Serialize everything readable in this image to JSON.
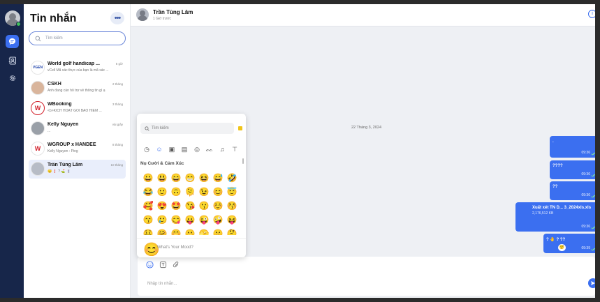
{
  "sidebar": {
    "title": "Tin nhắn",
    "search_placeholder": "Tìm kiếm",
    "conversations": [
      {
        "name": "World golf handicap ...",
        "time": "6 giờ",
        "preview": "vCell Mã xác thực của bạn là mã xác ...",
        "avatar": "VGEN"
      },
      {
        "name": "CSKH",
        "time": "2 tháng",
        "preview": "Anh đang cần hỗ trợ về thông tin gì ạ",
        "avatar": ""
      },
      {
        "name": "WBooking",
        "time": "3 tháng",
        "preview": "<b>KÍCH HOẠT GÓI BẢO HIỂM ...",
        "avatar": "W"
      },
      {
        "name": "Kelly Nguyen",
        "time": "vài giây",
        "preview": "...",
        "avatar": ""
      },
      {
        "name": "WGROUP x HANDEE",
        "time": "8 tháng",
        "preview": "Kelly Nguyen : Ping",
        "avatar": "W"
      },
      {
        "name": "Trần Tùng Lâm",
        "time": "10 tháng",
        "preview": "😴 ❗ ? ⛳ 💈",
        "avatar": ""
      }
    ]
  },
  "header": {
    "name": "Trần Tùng Lâm",
    "status": "1 Giờ trước"
  },
  "chat": {
    "date": "22 Tháng 3, 2024",
    "messages": [
      {
        "text": ".",
        "sub": "",
        "time": "09:36"
      },
      {
        "text": "????",
        "sub": "",
        "time": "09:36"
      },
      {
        "text": "??",
        "sub": "",
        "time": "09:36"
      },
      {
        "text": "Xuất xét TN D... 3_2024xls.xls",
        "sub": "2,176,512 KB",
        "time": "09:36"
      },
      {
        "text": "? 🤚 ? ??",
        "sub": "",
        "time": "09:39",
        "reaction": "😴"
      }
    ]
  },
  "composer": {
    "placeholder": "Nhập tin nhắn..."
  },
  "emoji_picker": {
    "search_placeholder": "Tìm kiếm",
    "section": "Nụ Cười & Cảm Xúc",
    "mood": "What's Your Mood?",
    "mood_emoji": "😊",
    "category_icons": [
      "clock-icon",
      "smiley-icon",
      "bus-icon",
      "car-icon",
      "ball-icon",
      "cat-icon",
      "music-icon",
      "shirt-icon"
    ],
    "emojis": [
      "😀",
      "😃",
      "😄",
      "😁",
      "😆",
      "😅",
      "🤣",
      "😂",
      "🙂",
      "🙃",
      "🫠",
      "😉",
      "😊",
      "😇",
      "🥰",
      "😍",
      "🤩",
      "😘",
      "😗",
      "☺️",
      "😚",
      "😙",
      "🥲",
      "😋",
      "😛",
      "😜",
      "🤪",
      "😝",
      "🤑",
      "🤗",
      "🤭",
      "🫢",
      "🫣",
      "🤫",
      "🤔",
      "🫡",
      "🤐",
      "🤨",
      "😐",
      "😑",
      "😶",
      "🫥"
    ]
  },
  "colors": {
    "accent": "#3b6ff0",
    "rail": "#17264a",
    "online": "#3fbf5a"
  }
}
